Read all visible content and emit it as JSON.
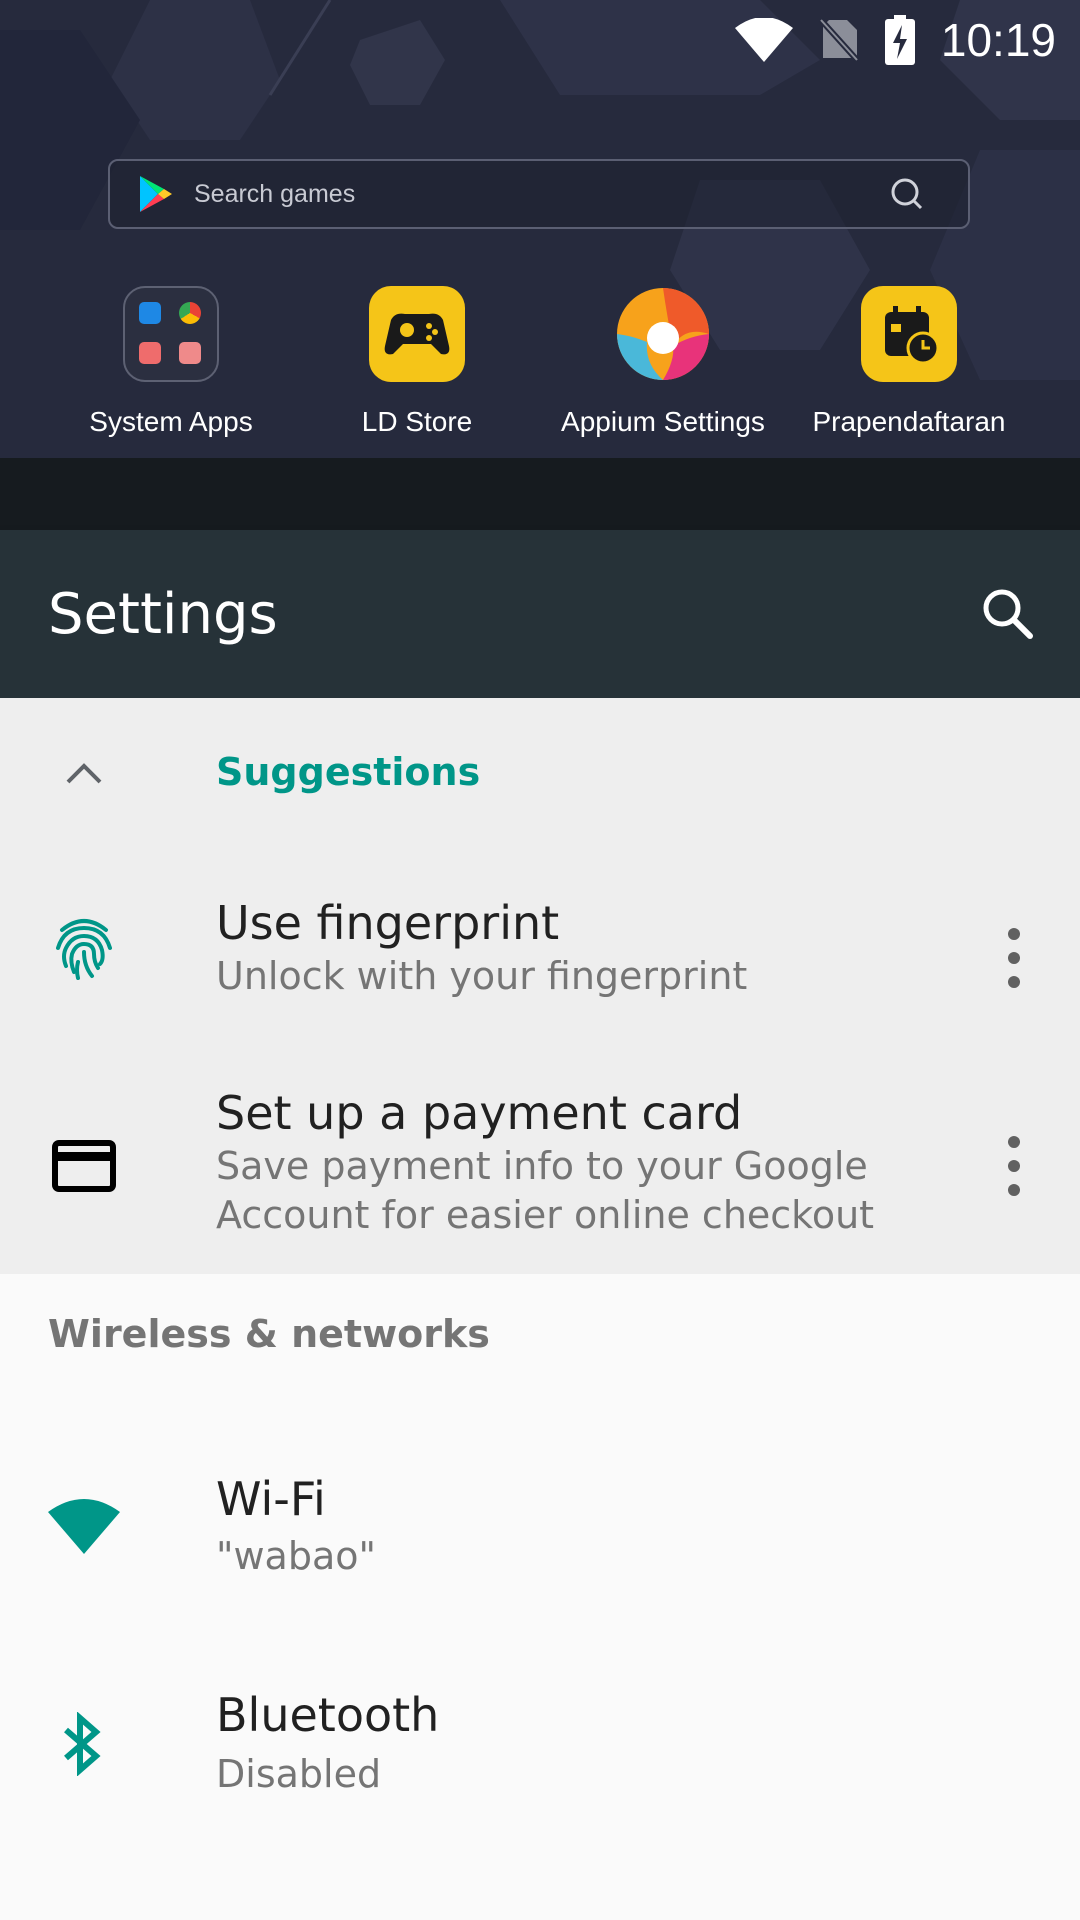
{
  "status_bar": {
    "time": "10:19",
    "icons": [
      "wifi-full-icon",
      "no-sim-icon",
      "battery-charging-icon"
    ]
  },
  "launcher": {
    "search_placeholder": "Search games",
    "apps": [
      {
        "label": "System Apps",
        "icon": "folder-icon"
      },
      {
        "label": "LD Store",
        "icon": "gamepad-icon",
        "color": "#f5c518"
      },
      {
        "label": "Appium Settings",
        "icon": "appium-logo-icon"
      },
      {
        "label": "Prapendaftaran",
        "icon": "calendar-clock-icon",
        "color": "#f5c518"
      }
    ]
  },
  "settings": {
    "title": "Settings",
    "suggestions": {
      "header": "Suggestions",
      "items": [
        {
          "title": "Use fingerprint",
          "summary": "Unlock with your fingerprint",
          "icon": "fingerprint-icon"
        },
        {
          "title": "Set up a payment card",
          "summary_line1": "Save payment info to your Google",
          "summary_line2": "Account for easier online checkout",
          "icon": "credit-card-icon"
        }
      ]
    },
    "sections": [
      {
        "title": "Wireless & networks",
        "items": [
          {
            "title": "Wi-Fi",
            "summary": "\"wabao\"",
            "icon": "wifi-icon"
          },
          {
            "title": "Bluetooth",
            "summary": "Disabled",
            "icon": "bluetooth-icon"
          }
        ]
      }
    ]
  },
  "colors": {
    "accent": "#009688",
    "toolbar": "#263238",
    "suggestion_bg": "#eeeeee",
    "page_bg": "#fafafa"
  }
}
